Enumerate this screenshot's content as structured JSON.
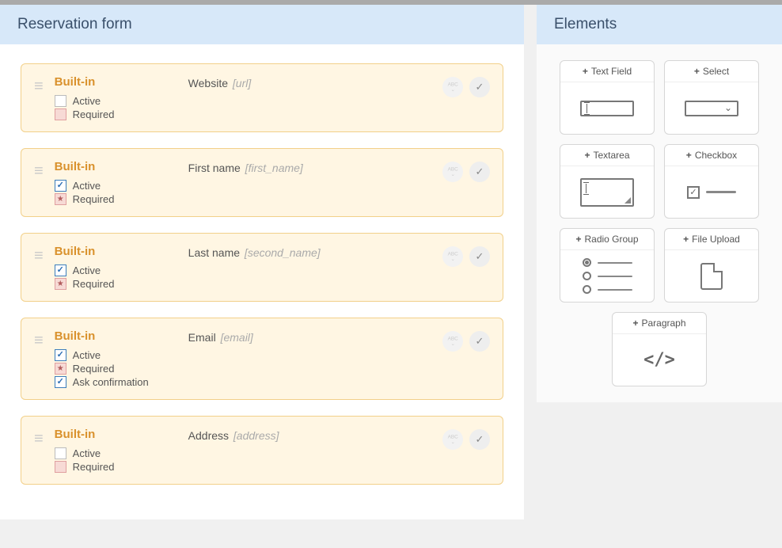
{
  "main": {
    "title": "Reservation form",
    "builtin_label": "Built-in",
    "flags": {
      "active": "Active",
      "required": "Required",
      "ask_confirmation": "Ask confirmation"
    },
    "fields": [
      {
        "label": "Website",
        "slug": "[url]",
        "active": false,
        "required": false,
        "required_star": false,
        "ask_confirmation": null
      },
      {
        "label": "First name",
        "slug": "[first_name]",
        "active": true,
        "required": true,
        "required_star": true,
        "ask_confirmation": null
      },
      {
        "label": "Last name",
        "slug": "[second_name]",
        "active": true,
        "required": true,
        "required_star": true,
        "ask_confirmation": null
      },
      {
        "label": "Email",
        "slug": "[email]",
        "active": true,
        "required": true,
        "required_star": true,
        "ask_confirmation": true
      },
      {
        "label": "Address",
        "slug": "[address]",
        "active": false,
        "required": false,
        "required_star": false,
        "ask_confirmation": null
      }
    ]
  },
  "side": {
    "title": "Elements",
    "items": [
      {
        "label": "Text Field",
        "kind": "textfield"
      },
      {
        "label": "Select",
        "kind": "select"
      },
      {
        "label": "Textarea",
        "kind": "textarea"
      },
      {
        "label": "Checkbox",
        "kind": "checkbox"
      },
      {
        "label": "Radio Group",
        "kind": "radiogroup"
      },
      {
        "label": "File Upload",
        "kind": "fileupload"
      },
      {
        "label": "Paragraph",
        "kind": "paragraph"
      }
    ]
  }
}
